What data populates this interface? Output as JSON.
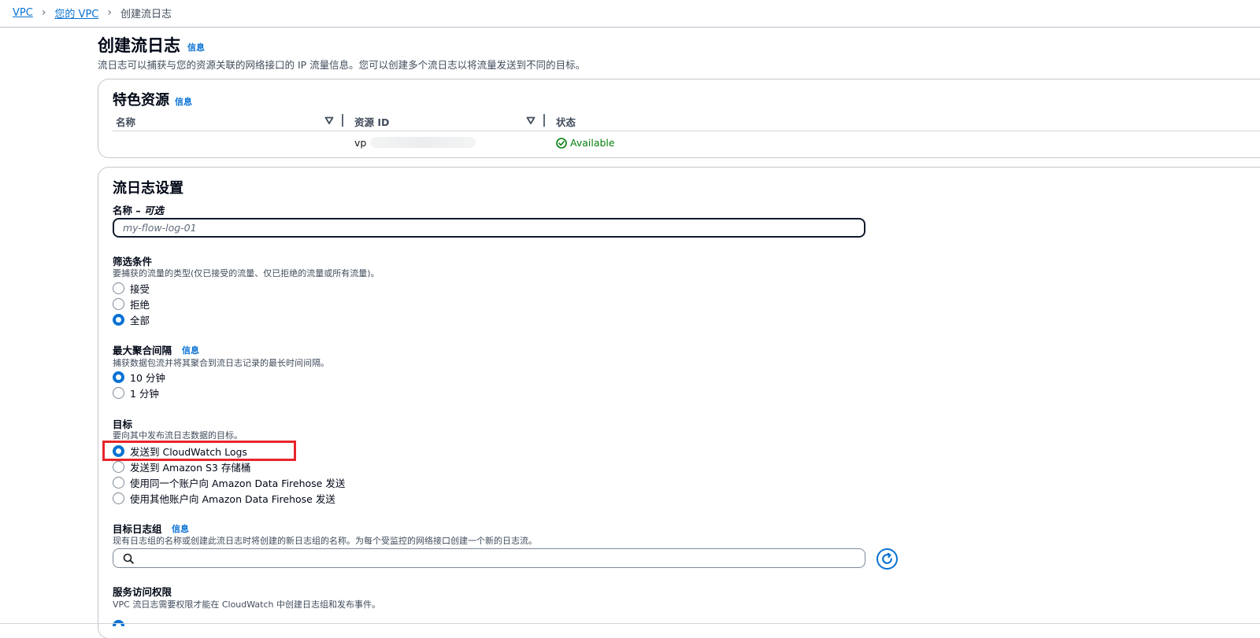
{
  "breadcrumb": {
    "vpc": "VPC",
    "your_vpc": "您的 VPC",
    "current": "创建流日志"
  },
  "page": {
    "title": "创建流日志",
    "info": "信息",
    "description": "流日志可以捕获与您的资源关联的网络接口的 IP 流量信息。您可以创建多个流日志以将流量发送到不同的目标。"
  },
  "resources": {
    "title": "特色资源",
    "info": "信息",
    "columns": [
      "名称",
      "资源 ID",
      "状态"
    ],
    "row": {
      "name": "",
      "resource_id": "vp",
      "status": "Available"
    }
  },
  "settings": {
    "title": "流日志设置",
    "name_label": "名称 – ",
    "name_optional": "可选",
    "name_placeholder": "my-flow-log-01",
    "filter": {
      "label": "筛选条件",
      "desc": "要捕获的流量的类型(仅已接受的流量、仅已拒绝的流量或所有流量)。",
      "options": [
        "接受",
        "拒绝",
        "全部"
      ],
      "selected": "全部"
    },
    "interval": {
      "label": "最大聚合间隔",
      "info": "信息",
      "desc": "捕获数据包流并将其聚合到流日志记录的最长时间间隔。",
      "options": [
        "10 分钟",
        "1 分钟"
      ],
      "selected": "10 分钟"
    },
    "destination": {
      "label": "目标",
      "desc": "要向其中发布流日志数据的目标。",
      "options": [
        "发送到 CloudWatch Logs",
        "发送到 Amazon S3 存储桶",
        "使用同一个账户向 Amazon Data Firehose 发送",
        "使用其他账户向 Amazon Data Firehose 发送"
      ],
      "selected": "发送到 CloudWatch Logs"
    },
    "log_group": {
      "label": "目标日志组",
      "info": "信息",
      "desc": "现有日志组的名称或创建此流日志时将创建的新日志组的名称。为每个受监控的网络接口创建一个新的日志流。",
      "value": ""
    },
    "access": {
      "label": "服务访问权限",
      "desc": "VPC 流日志需要权限才能在 CloudWatch 中创建日志组和发布事件。"
    }
  },
  "colors": {
    "accent": "#0972d3",
    "success": "#037f0c",
    "highlight": "#e8252b"
  },
  "icons": [
    "chevron-right-icon",
    "sort-down-icon",
    "check-circle-icon",
    "search-icon",
    "refresh-icon"
  ]
}
